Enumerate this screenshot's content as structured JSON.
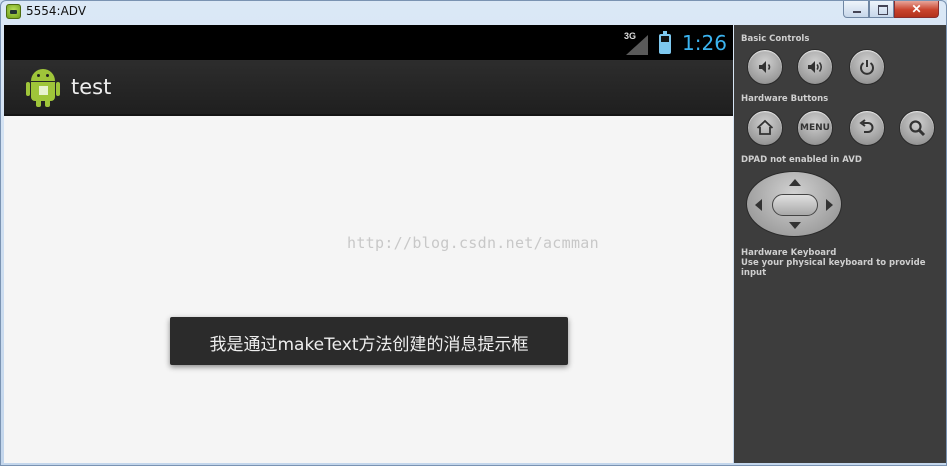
{
  "window": {
    "title": "5554:ADV",
    "close_glyph": "✕"
  },
  "device": {
    "status_bar": {
      "network_type": "3G",
      "time": "1:26"
    },
    "action_bar": {
      "app_title": "test"
    },
    "watermark": "http://blog.csdn.net/acmman",
    "toast": "我是通过makeText方法创建的消息提示框"
  },
  "controls": {
    "basic_controls_label": "Basic Controls",
    "hardware_buttons_label": "Hardware Buttons",
    "menu_label": "MENU",
    "dpad_label": "DPAD not enabled in AVD",
    "keyboard_title": "Hardware Keyboard",
    "keyboard_desc": "Use your physical keyboard to provide input"
  },
  "colors": {
    "accent_clock": "#3bb3ef",
    "action_bar": "#2a2a2a",
    "panel": "#3d3d3d",
    "android_green": "#9fc53a"
  },
  "icons": [
    "volume-down-icon",
    "volume-up-icon",
    "power-icon",
    "home-icon",
    "back-icon",
    "search-icon",
    "android-logo-icon",
    "battery-icon",
    "signal-icon"
  ]
}
